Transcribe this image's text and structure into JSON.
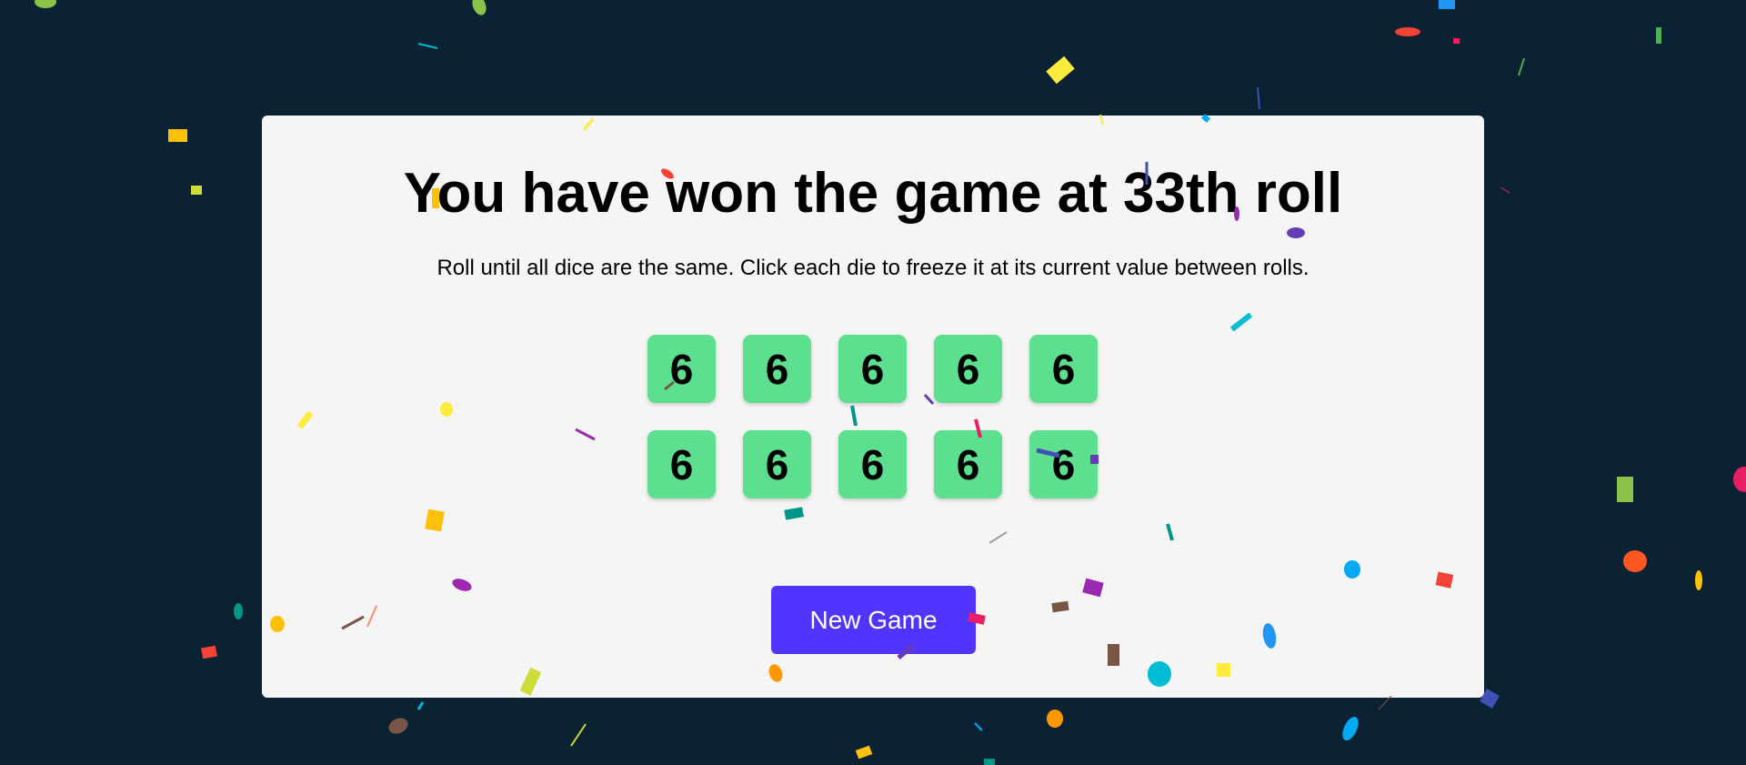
{
  "game": {
    "title": "You have won the game at 33th roll",
    "instructions": "Roll until all dice are the same. Click each die to freeze it at its current value between rolls.",
    "dice": [
      {
        "value": "6",
        "held": true
      },
      {
        "value": "6",
        "held": true
      },
      {
        "value": "6",
        "held": true
      },
      {
        "value": "6",
        "held": true
      },
      {
        "value": "6",
        "held": true
      },
      {
        "value": "6",
        "held": true
      },
      {
        "value": "6",
        "held": true
      },
      {
        "value": "6",
        "held": true
      },
      {
        "value": "6",
        "held": true
      },
      {
        "value": "6",
        "held": true
      }
    ],
    "new_game_label": "New Game"
  },
  "colors": {
    "background": "#0b2233",
    "panel": "#f5f5f5",
    "die_held": "#5ce08f",
    "button": "#5035ff"
  },
  "decorations": {
    "confetti": "falling-confetti-celebration"
  }
}
